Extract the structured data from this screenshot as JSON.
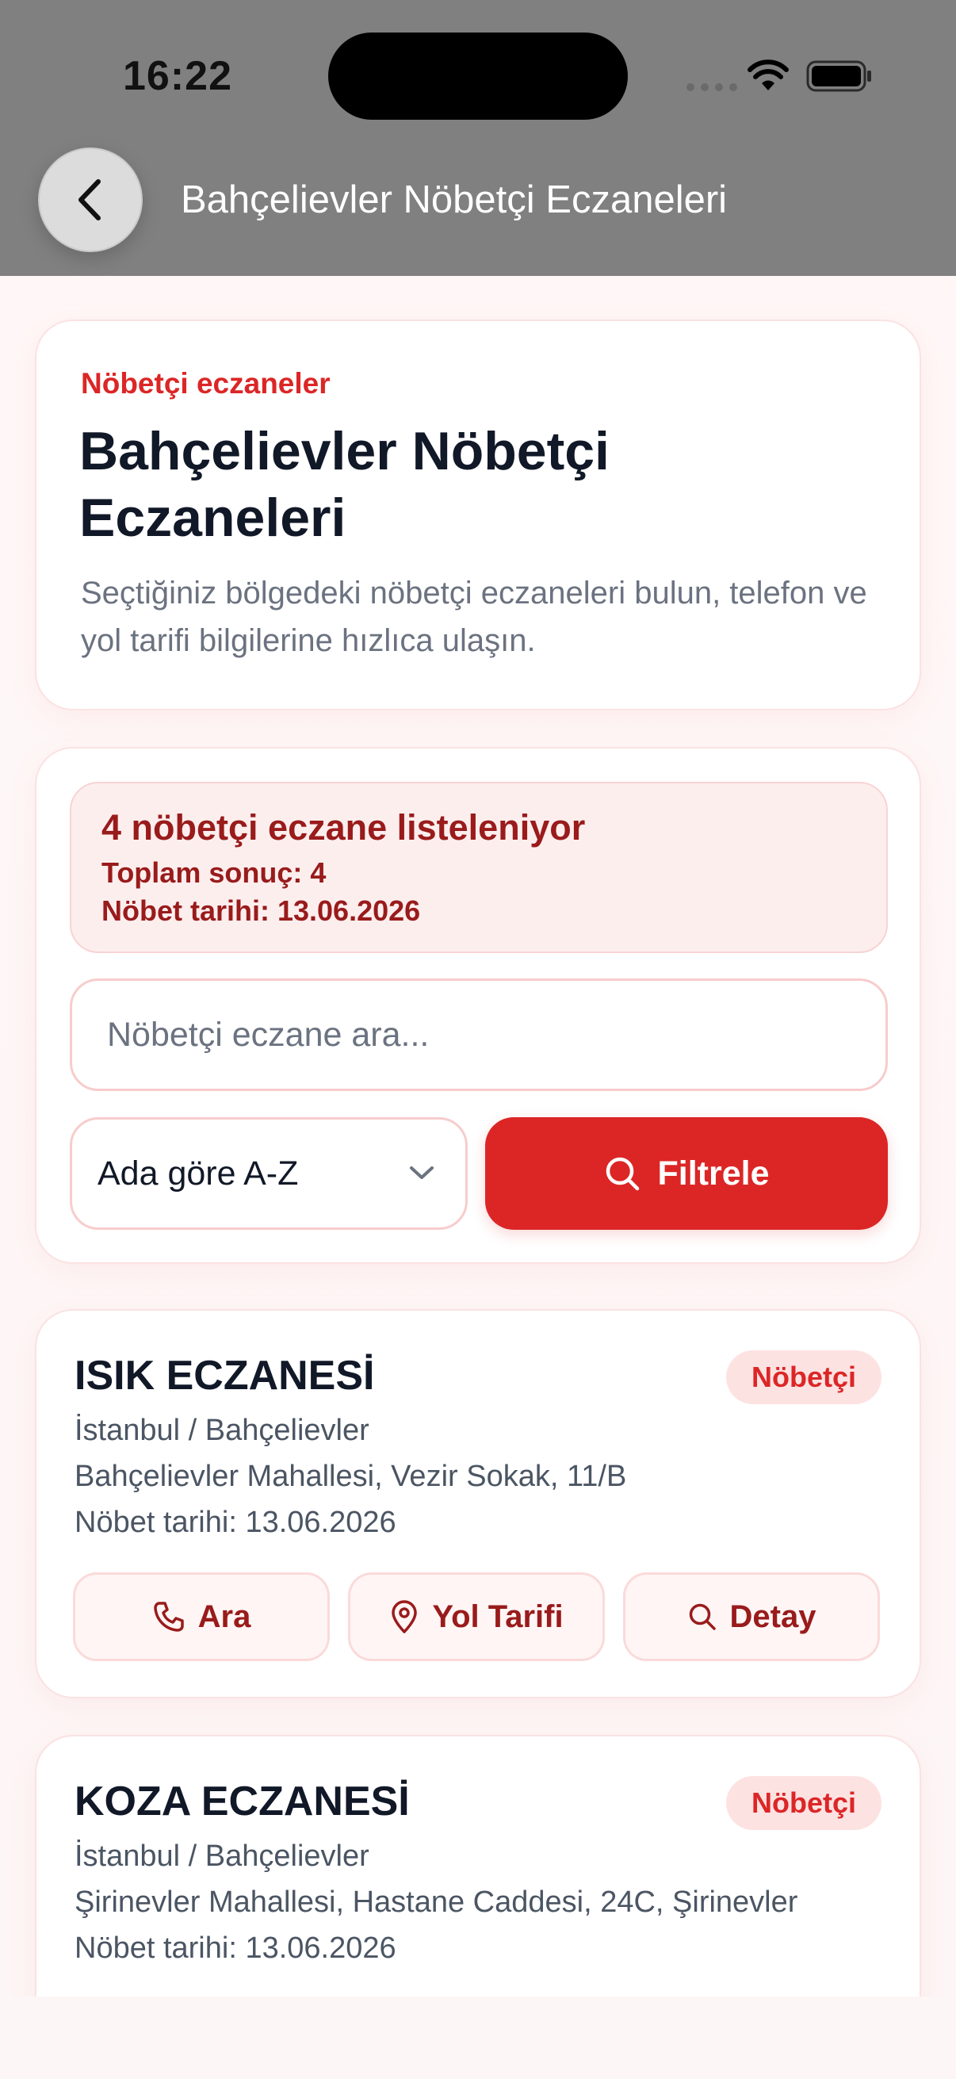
{
  "status_bar": {
    "time": "16:22"
  },
  "header": {
    "title": "Bahçelievler Nöbetçi Eczaneleri",
    "back_icon": "chevron-left-icon"
  },
  "intro": {
    "eyebrow": "Nöbetçi eczaneler",
    "title": "Bahçelievler Nöbetçi Eczaneleri",
    "description": "Seçtiğiniz bölgedeki nöbetçi eczaneleri bulun, telefon ve yol tarifi bilgilerine hızlıca ulaşın."
  },
  "filter": {
    "summary_title": "4 nöbetçi eczane listeleniyor",
    "summary_total": "Toplam sonuç: 4",
    "summary_date": "Nöbet tarihi: 13.06.2026",
    "search_placeholder": "Nöbetçi eczane ara...",
    "search_value": "",
    "sort_selected": "Ada göre A-Z",
    "filter_button": "Filtrele"
  },
  "pharmacies": [
    {
      "name": "ISIK ECZANESİ",
      "badge": "Nöbetçi",
      "district": "İstanbul / Bahçelievler",
      "address": "Bahçelievler Mahallesi, Vezir Sokak, 11/B",
      "date": "Nöbet tarihi: 13.06.2026",
      "call_label": "Ara",
      "route_label": "Yol Tarifi",
      "detail_label": "Detay"
    },
    {
      "name": "KOZA ECZANESİ",
      "badge": "Nöbetçi",
      "district": "İstanbul / Bahçelievler",
      "address": "Şirinevler Mahallesi, Hastane Caddesi, 24C, Şirinevler",
      "date": "Nöbet tarihi: 13.06.2026"
    }
  ],
  "colors": {
    "accent": "#dc2626",
    "accent_dark": "#991b1b",
    "header_bg": "#808080",
    "badge_bg": "#fde2e2",
    "summary_bg": "#fdeeee",
    "text_primary": "#111827",
    "text_secondary": "#4b5563"
  }
}
